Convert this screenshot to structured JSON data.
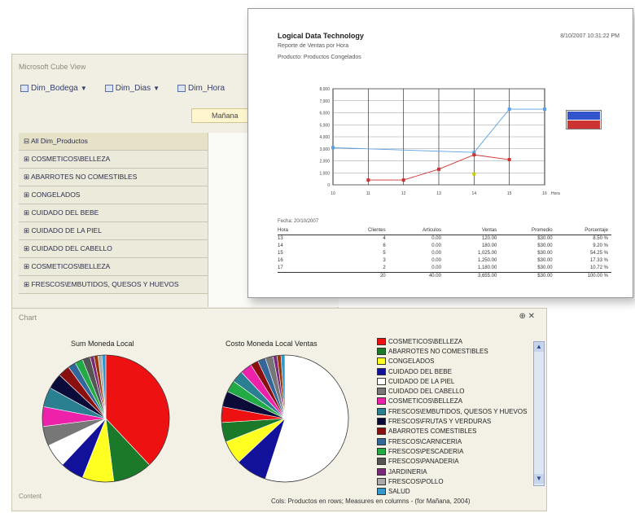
{
  "pivot": {
    "title": "Microsoft Cube View",
    "dimensions": [
      "Dim_Bodega",
      "Dim_Dias",
      "Dim_Hora"
    ],
    "measure_tab": "Mañana",
    "rows": [
      "All Dim_Productos",
      "COSMETICOS\\BELLEZA",
      "ABARROTES NO COMESTIBLES",
      "CONGELADOS",
      "CUIDADO DEL BEBE",
      "CUIDADO DE LA PIEL",
      "CUIDADO DEL CABELLO",
      "COSMETICOS\\BELLEZA",
      "FRESCOS\\EMBUTIDOS, QUESOS Y HUEVOS"
    ]
  },
  "report": {
    "company": "Logical Data Technology",
    "subtitle": "Reporte de Ventas por Hora",
    "filter": "Producto: Productos Congelados",
    "date": "8/10/2007  10:31:22 PM",
    "measures_label": "Fecha:  20/10/2007",
    "table_headers": [
      "Hora",
      "Clientes",
      "Articulos",
      "Ventas",
      "Promedio",
      "Porcentaje"
    ],
    "table_rows": [
      [
        "13",
        "4",
        "0.00",
        "120.00",
        "$30.00",
        "8.50 %"
      ],
      [
        "14",
        "6",
        "0.00",
        "180.00",
        "$30.00",
        "9.20 %"
      ],
      [
        "15",
        "5",
        "0.00",
        "1,025.00",
        "$30.00",
        "54.25 %"
      ],
      [
        "16",
        "3",
        "0.00",
        "1,250.00",
        "$30.00",
        "17.33 %"
      ],
      [
        "17",
        "2",
        "0.00",
        "1,180.00",
        "$30.00",
        "10.72 %"
      ]
    ],
    "table_total": [
      "",
      "20",
      "40.00",
      "3,655.00",
      "$30.00",
      "100.00 %"
    ]
  },
  "chart_panel": {
    "title": "Chart",
    "controls": "⊕ ✕",
    "footer_left": "Content",
    "footer": "Cols: Productos en rows; Measures en columns - (for Mañana, 2004)"
  },
  "chart_data": [
    {
      "type": "line",
      "title": "",
      "x": [
        10,
        11,
        12,
        13,
        14,
        15,
        16
      ],
      "x_tick_labels": [
        "10",
        "11",
        "12",
        "13",
        "14",
        "15",
        "16"
      ],
      "x_end_label": "Hora",
      "y_ticks": [
        "0",
        "1,000",
        "2,000",
        "3,000",
        "4,000",
        "5,000",
        "6,000",
        "7,000",
        "8,000"
      ],
      "ylim": [
        0,
        8000
      ],
      "grid": true,
      "series": [
        {
          "name": "",
          "color": "#5aa0e6",
          "values": [
            3100,
            null,
            null,
            null,
            2700,
            6300,
            6300
          ]
        },
        {
          "name": "",
          "color": "#cc3333",
          "values": [
            null,
            400,
            400,
            1300,
            2500,
            2100,
            null
          ]
        },
        {
          "name": "",
          "color": "#cccc00",
          "values": [
            null,
            null,
            null,
            null,
            900,
            null,
            null
          ]
        }
      ],
      "legend_colors": [
        "#3355cc",
        "#cc3333",
        "#dddd00"
      ]
    },
    {
      "type": "pie",
      "title": "Sum Moneda Local",
      "values": [
        38,
        10,
        8,
        6,
        6,
        5,
        5,
        5,
        4,
        3,
        2,
        2,
        2,
        1,
        1,
        1,
        1
      ],
      "colors": [
        "#ee1111",
        "#1b7a2a",
        "#ffff22",
        "#11119a",
        "#ffffff",
        "#777777",
        "#ee22aa",
        "#2a7f90",
        "#0b0b3a",
        "#8a1010",
        "#336699",
        "#22aa44",
        "#555555",
        "#7a2a7a",
        "#993300",
        "#aaaaaa",
        "#3399cc"
      ]
    },
    {
      "type": "pie",
      "title": "Costo Moneda Local Ventas",
      "values": [
        55,
        8,
        6,
        5,
        4,
        4,
        3,
        3,
        3,
        2,
        2,
        2,
        1,
        1,
        1
      ],
      "colors": [
        "#ffffff",
        "#11119a",
        "#ffff22",
        "#1b7a2a",
        "#ee1111",
        "#0b0b3a",
        "#22aa44",
        "#2a7f90",
        "#ee22aa",
        "#8a1010",
        "#336699",
        "#777777",
        "#7a2a7a",
        "#993300",
        "#3399cc"
      ]
    }
  ],
  "legend": {
    "items": [
      {
        "label": "COSMETICOS\\BELLEZA",
        "color": "#ee1111"
      },
      {
        "label": "ABARROTES NO COMESTIBLES",
        "color": "#1b7a2a"
      },
      {
        "label": "CONGELADOS",
        "color": "#ffff22"
      },
      {
        "label": "CUIDADO DEL BEBE",
        "color": "#11119a"
      },
      {
        "label": "CUIDADO DE LA PIEL",
        "color": "#ffffff"
      },
      {
        "label": "CUIDADO DEL CABELLO",
        "color": "#777777"
      },
      {
        "label": "COSMETICOS\\BELLEZA",
        "color": "#ee22aa"
      },
      {
        "label": "FRESCOS\\EMBUTIDOS, QUESOS Y HUEVOS",
        "color": "#2a7f90"
      },
      {
        "label": "FRESCOS\\FRUTAS Y VERDURAS",
        "color": "#0b0b3a"
      },
      {
        "label": "ABARROTES COMESTIBLES",
        "color": "#8a1010"
      },
      {
        "label": "FRESCOS\\CARNICERIA",
        "color": "#336699"
      },
      {
        "label": "FRESCOS\\PESCADERIA",
        "color": "#22aa44"
      },
      {
        "label": "FRESCOS\\PANADERIA",
        "color": "#555555"
      },
      {
        "label": "JARDINERIA",
        "color": "#7a2a7a"
      },
      {
        "label": "FRESCOS\\POLLO",
        "color": "#aaaaaa"
      },
      {
        "label": "SALUD",
        "color": "#3399cc"
      }
    ]
  }
}
